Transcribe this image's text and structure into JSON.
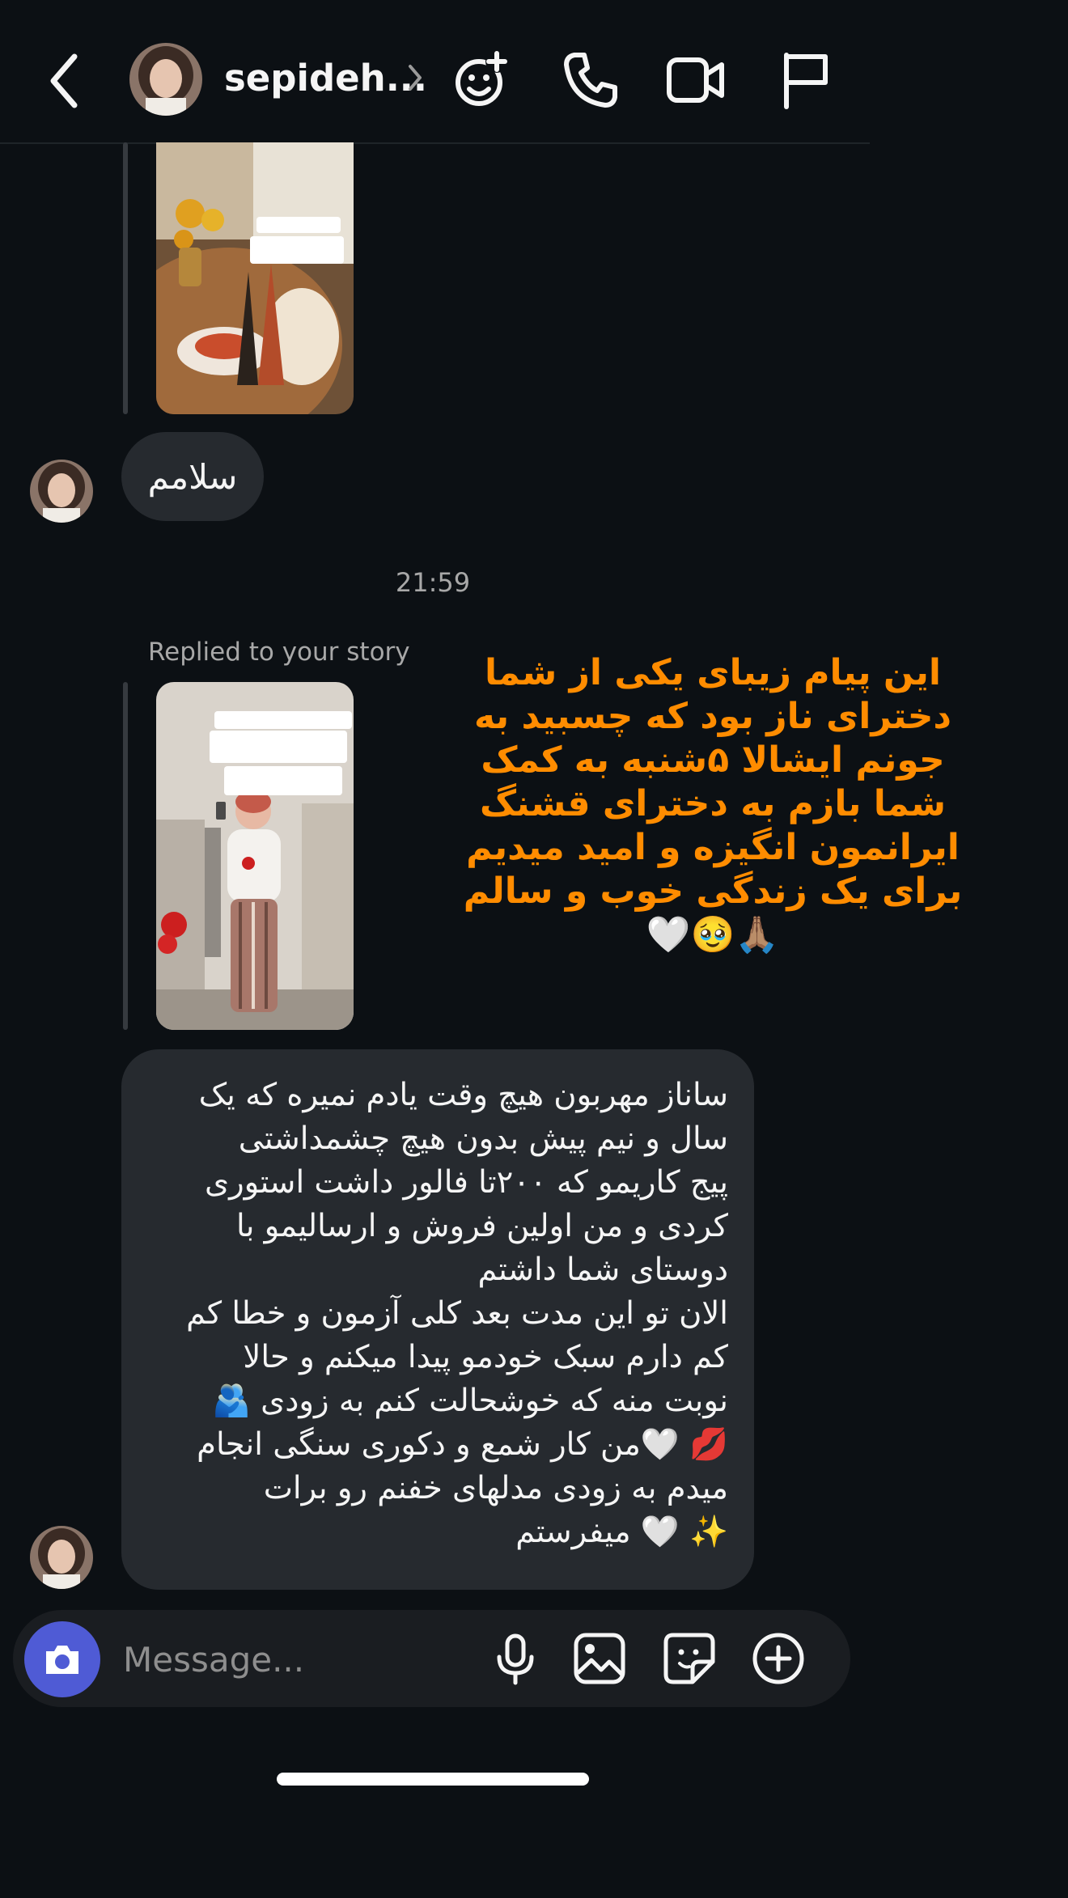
{
  "header": {
    "title": "sepideh...",
    "icons": [
      "back-arrow-icon",
      "chevron-right-icon",
      "smiley-plus-icon",
      "phone-icon",
      "video-camera-icon",
      "flag-icon"
    ]
  },
  "thread": {
    "msg1": "سلامم",
    "time": "21:59",
    "replied_label": "Replied to your story",
    "msg2_p1": "ساناز مهربون هیچ وقت یادم نمیره که یک\nسال و نیم  پیش بدون هیچ چشمداشتی\nپیج کاریمو  که ۲۰۰تا فالور داشت استوری\nکردی  و من اولین فروش و ارسالیمو با\nدوستای شما داشتم",
    "msg2_p2": "الان تو این مدت بعد کلی آزمون و خطا کم\nکم دارم سبک خودمو پیدا میکنم و حالا\nنوبت منه که خوشحالت کنم به زودی 🫂\n💋 🤍من کار شمع و دکوری سنگی انجام\nمیدم به زودی مدلهای خفنم رو برات\n✨ 🤍 میفرستم"
  },
  "overlay": {
    "text": "این پیام زیبای یکی از شما\nدخترای ناز بود که چسبید به\nجونم ایشالا ۵شنبه به کمک\nشما بازم به دخترای قشنگ\nایرانمون انگیزه و امید میدیم\nبرای یک زندگی خوب و سالم\n🙏🏽🥹🤍"
  },
  "composer": {
    "placeholder": "Message...",
    "icons": [
      "camera-icon",
      "microphone-icon",
      "gallery-icon",
      "sticker-icon",
      "plus-circle-icon"
    ]
  },
  "colors": {
    "background": "#0c1014",
    "bubble": "#262a2f",
    "overlay_text": "#ff8c00",
    "camera_button": "#4f5bd5",
    "muted_text": "#a8a8a8"
  }
}
